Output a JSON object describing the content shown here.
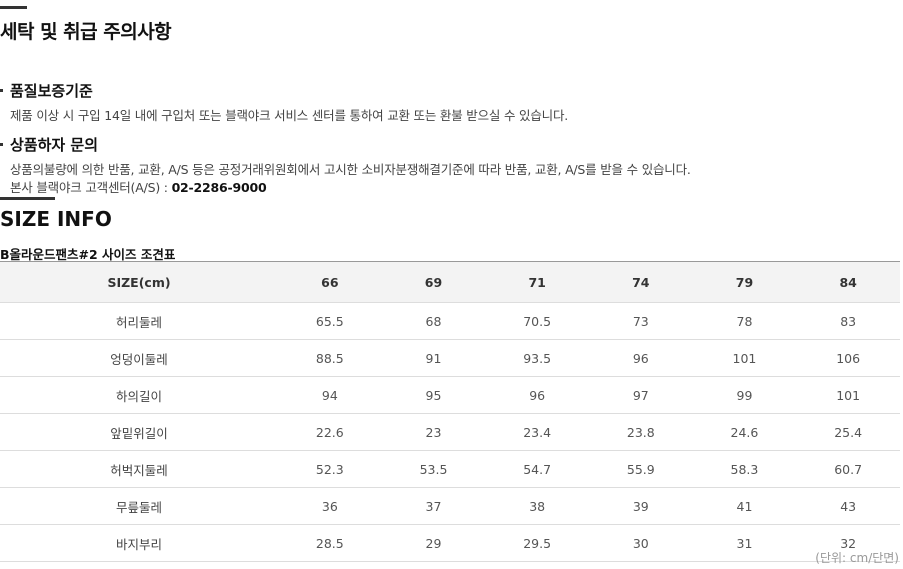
{
  "care": {
    "title": "세탁 및 취급 주의사항",
    "quality": {
      "heading": "품질보증기준",
      "text": "제품 이상 시 구입 14일 내에 구입처 또는 블랙야크 서비스 센터를 통하여 교환 또는 환불 받으실 수 있습니다."
    },
    "defect": {
      "heading": "상품하자 문의",
      "text": "상품의불량에 의한 반품, 교환, A/S 등은 공정거래위원회에서 고시한 소비자분쟁해결기준에 따라 반품, 교환, A/S를 받을 수 있습니다.",
      "contact_label": "본사 블랙야크 고객센터(A/S) : ",
      "contact_phone": "02-2286-9000"
    }
  },
  "size_info": {
    "title": "SIZE INFO",
    "table_title": "B올라운드팬츠#2 사이즈 조견표",
    "header": [
      "SIZE(cm)",
      "66",
      "69",
      "71",
      "74",
      "79",
      "84"
    ],
    "rows": [
      [
        "허리둘레",
        "65.5",
        "68",
        "70.5",
        "73",
        "78",
        "83"
      ],
      [
        "엉덩이둘레",
        "88.5",
        "91",
        "93.5",
        "96",
        "101",
        "106"
      ],
      [
        "하의길이",
        "94",
        "95",
        "96",
        "97",
        "99",
        "101"
      ],
      [
        "앞밑위길이",
        "22.6",
        "23",
        "23.4",
        "23.8",
        "24.6",
        "25.4"
      ],
      [
        "허벅지둘레",
        "52.3",
        "53.5",
        "54.7",
        "55.9",
        "58.3",
        "60.7"
      ],
      [
        "무릎둘레",
        "36",
        "37",
        "38",
        "39",
        "41",
        "43"
      ],
      [
        "바지부리",
        "28.5",
        "29",
        "29.5",
        "30",
        "31",
        "32"
      ]
    ],
    "unit_note": "(단위: cm/단면)"
  }
}
